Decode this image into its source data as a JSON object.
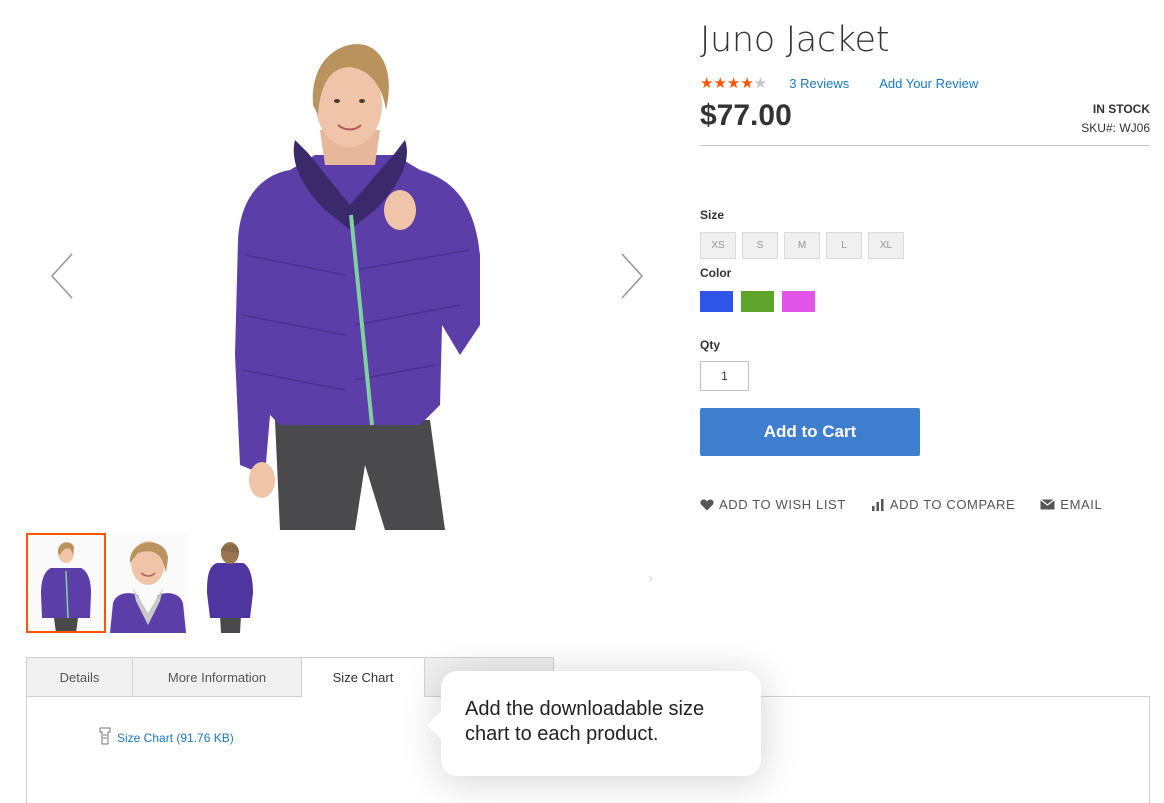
{
  "gallery": {
    "main_image_alt": "woman-in-purple-jacket",
    "prev_icon": "chevron-left-icon",
    "next_icon": "chevron-right-icon",
    "thumbnails": [
      {
        "name": "thumb-front",
        "active": true
      },
      {
        "name": "thumb-closeup",
        "active": false
      },
      {
        "name": "thumb-back",
        "active": false
      }
    ]
  },
  "product": {
    "title": "Juno Jacket",
    "rating": 4.5,
    "stars": "★★★★★",
    "reviews_label": "3  Reviews",
    "add_review_label": "Add Your Review",
    "price": "$77.00",
    "stock": "IN STOCK",
    "sku": "SKU#:  WJ06"
  },
  "options": {
    "size_label": "Size",
    "sizes": [
      "XS",
      "S",
      "M",
      "L",
      "XL"
    ],
    "color_label": "Color",
    "colors": [
      "#2f55e6",
      "#5fa32b",
      "#e154e8"
    ],
    "qty_label": "Qty",
    "qty_value": "1"
  },
  "cart": {
    "add_to_cart_label": "Add to Cart"
  },
  "actions": {
    "wishlist": "ADD TO WISH LIST",
    "compare": "ADD TO COMPARE",
    "email": "EMAIL"
  },
  "tabs": {
    "items": [
      "Details",
      "More Information",
      "Size Chart",
      ""
    ],
    "active": "Size Chart"
  },
  "size_chart": {
    "link_label": "Size Chart (91.76 KB)"
  },
  "callout": {
    "text": "Add the downloadable size chart to each product."
  },
  "colors": {
    "accent": "#1979c3",
    "button": "#3f7ecf",
    "star": "#ff5501"
  }
}
